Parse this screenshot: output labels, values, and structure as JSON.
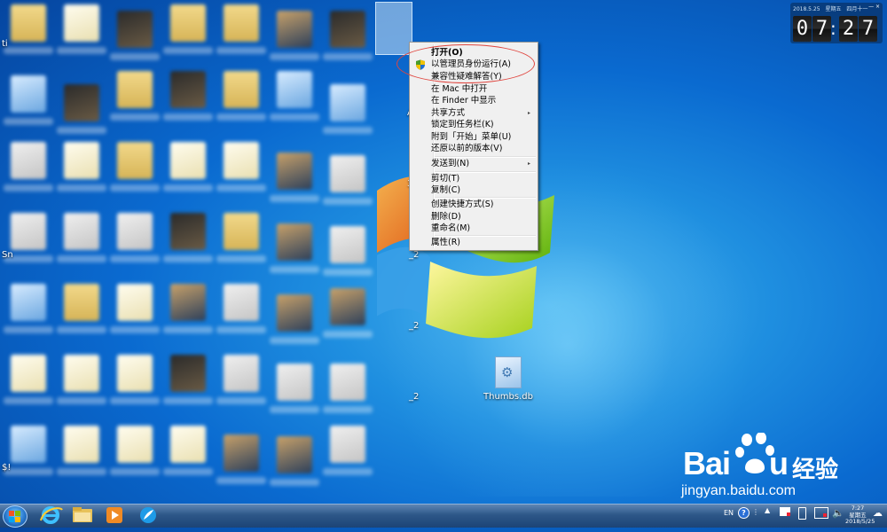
{
  "desktop": {
    "side_chars": [
      "ti",
      "A",
      "3",
      "Sn",
      "$!",
      "_2",
      "_2",
      "_2"
    ],
    "thumbs_label": "Thumbs.db"
  },
  "clock": {
    "date": "2018.5.25",
    "weekday": "星期五",
    "lunar": "四月十一",
    "controls": "— ×",
    "hour_tens": "0",
    "hour_ones": "7",
    "min_tens": "2",
    "min_ones": "7"
  },
  "context_menu": {
    "items": [
      {
        "label": "打开(O)"
      },
      {
        "label": "以管理员身份运行(A)"
      },
      {
        "label": "兼容性疑难解答(Y)"
      },
      {
        "label": "在 Mac 中打开"
      },
      {
        "label": "在 Finder 中显示"
      },
      {
        "label": "共享方式"
      },
      {
        "label": "锁定到任务栏(K)"
      },
      {
        "label": "附到「开始」菜单(U)"
      },
      {
        "label": "还原以前的版本(V)"
      },
      {
        "label": "发送到(N)"
      },
      {
        "label": "剪切(T)"
      },
      {
        "label": "复制(C)"
      },
      {
        "label": "创建快捷方式(S)"
      },
      {
        "label": "删除(D)"
      },
      {
        "label": "重命名(M)"
      },
      {
        "label": "属性(R)"
      }
    ],
    "submenu_arrow": "▸"
  },
  "taskbar": {
    "language": "EN",
    "help": "?",
    "time": "7:27",
    "weekday": "星期五",
    "date": "2018/5/25"
  },
  "watermark": {
    "brand": "Bai",
    "brand_end": "u",
    "cn": "经验",
    "url": "jingyan.baidu.com"
  },
  "colors": {
    "highlight_oval": "#e0463f",
    "taskbar": "#2d5788",
    "desktop": "#0a6ad0"
  }
}
